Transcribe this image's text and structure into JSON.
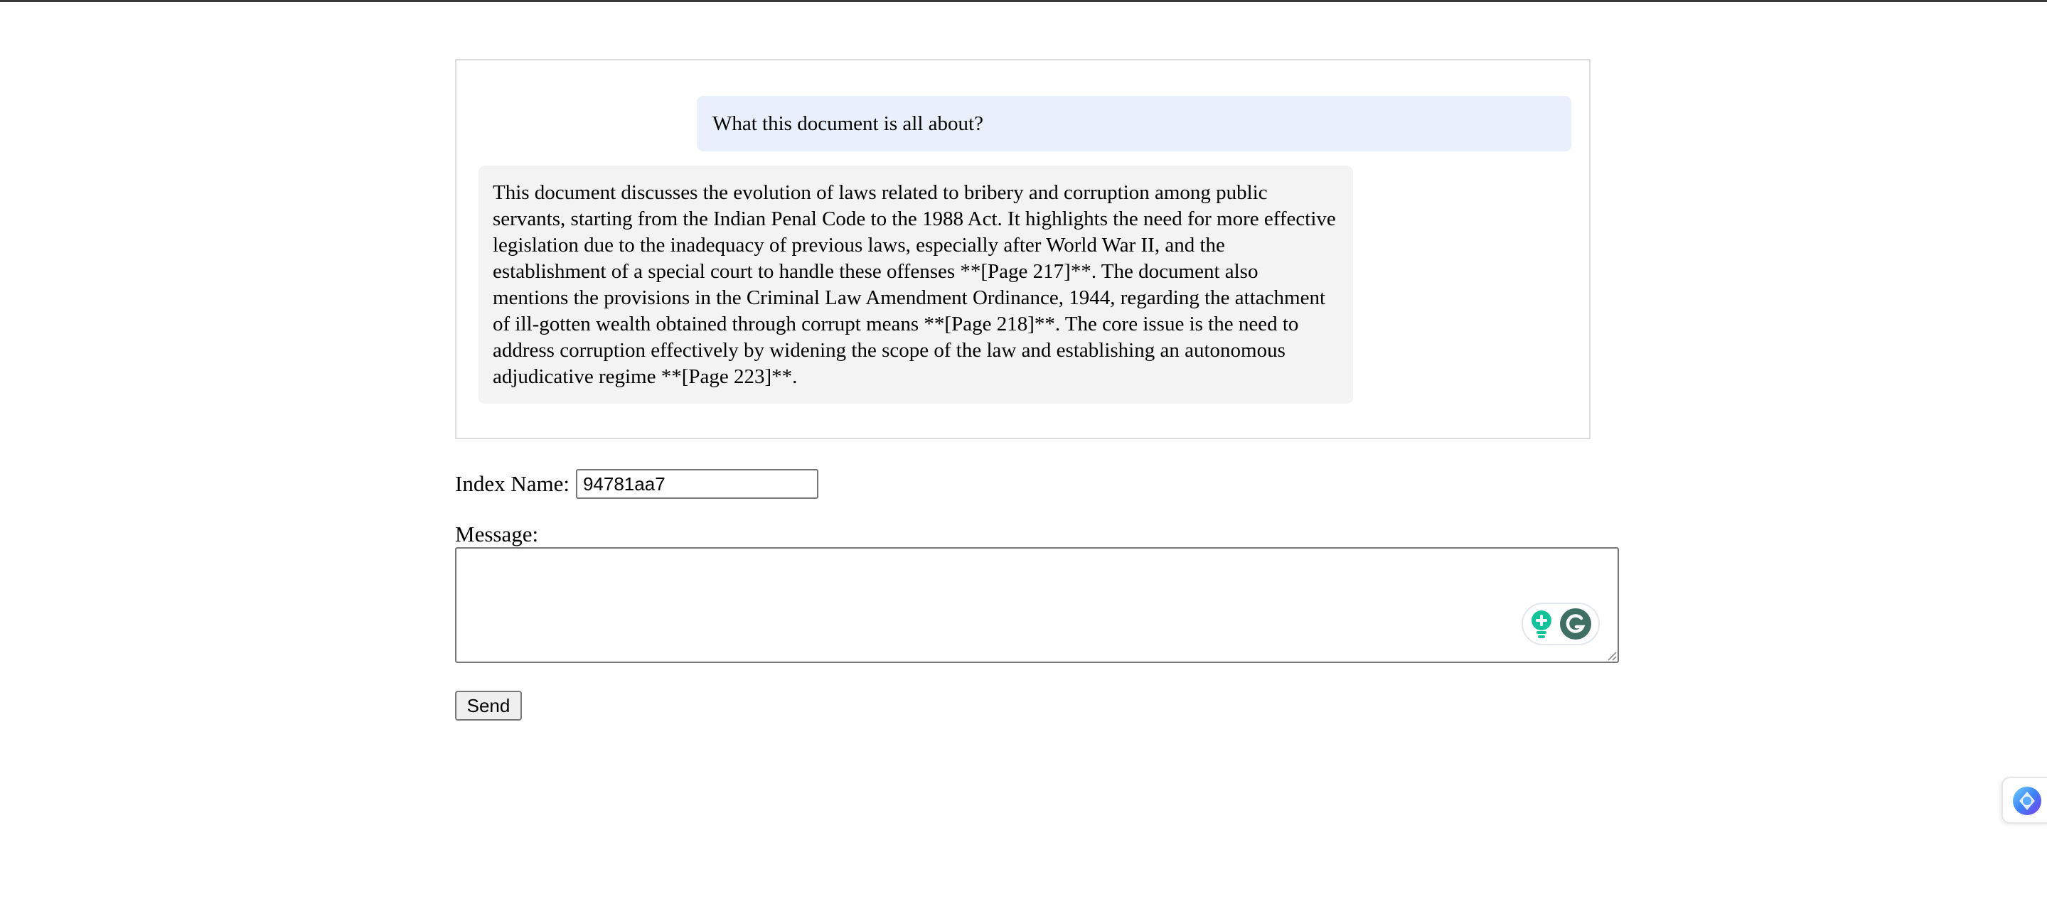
{
  "chat": {
    "user_message": "What this document is all about?",
    "bot_message": "This document discusses the evolution of laws related to bribery and corruption among public servants, starting from the Indian Penal Code to the 1988 Act. It highlights the need for more effective legislation due to the inadequacy of previous laws, especially after World War II, and the establishment of a special court to handle these offenses **[Page 217]**. The document also mentions the provisions in the Criminal Law Amendment Ordinance, 1944, regarding the attachment of ill-gotten wealth obtained through corrupt means **[Page 218]**. The core issue is the need to address corruption effectively by widening the scope of the law and establishing an autonomous adjudicative regime **[Page 223]**."
  },
  "form": {
    "index_label": "Index Name:",
    "index_value": "94781aa7",
    "message_label": "Message:",
    "message_value": "",
    "send_label": "Send"
  },
  "icons": {
    "grammarly_suggest": "lightbulb-plus-icon",
    "grammarly_logo": "grammarly-g-icon",
    "side_widget": "assistant-orb-icon"
  },
  "colors": {
    "user_bubble": "#e9f0fb",
    "bot_bubble": "#f3f3f3",
    "grammarly_green": "#15c39a",
    "grammarly_dark": "#3f6e62"
  }
}
